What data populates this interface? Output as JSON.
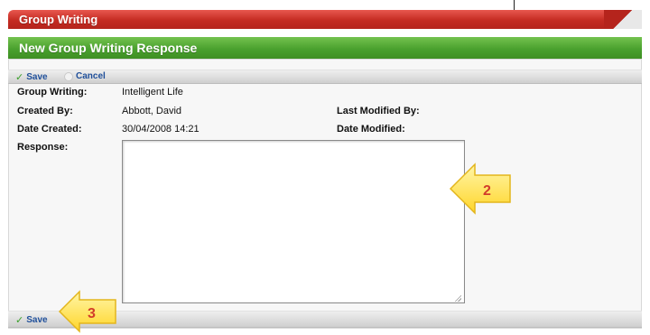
{
  "window": {
    "section_title": "Group Writing",
    "page_title": "New Group Writing Response"
  },
  "toolbar": {
    "save_label": "Save",
    "cancel_label": "Cancel"
  },
  "form": {
    "group_writing_label": "Group Writing:",
    "group_writing_value": "Intelligent Life",
    "created_by_label": "Created By:",
    "created_by_value": "Abbott, David",
    "last_modified_by_label": "Last Modified By:",
    "last_modified_by_value": "",
    "date_created_label": "Date Created:",
    "date_created_value": "30/04/2008 14:21",
    "date_modified_label": "Date Modified:",
    "date_modified_value": "",
    "response_label": "Response:",
    "response_value": ""
  },
  "callouts": {
    "response_marker": "2",
    "save_marker": "3"
  },
  "colors": {
    "header_red": "#c42b22",
    "header_green": "#4aa12e",
    "link_blue": "#1f4f9a",
    "callout_yellow": "#ffe45c",
    "callout_number": "#d23c2a"
  },
  "icons": {
    "save": "check-icon",
    "cancel": "cancel-circle-icon"
  }
}
